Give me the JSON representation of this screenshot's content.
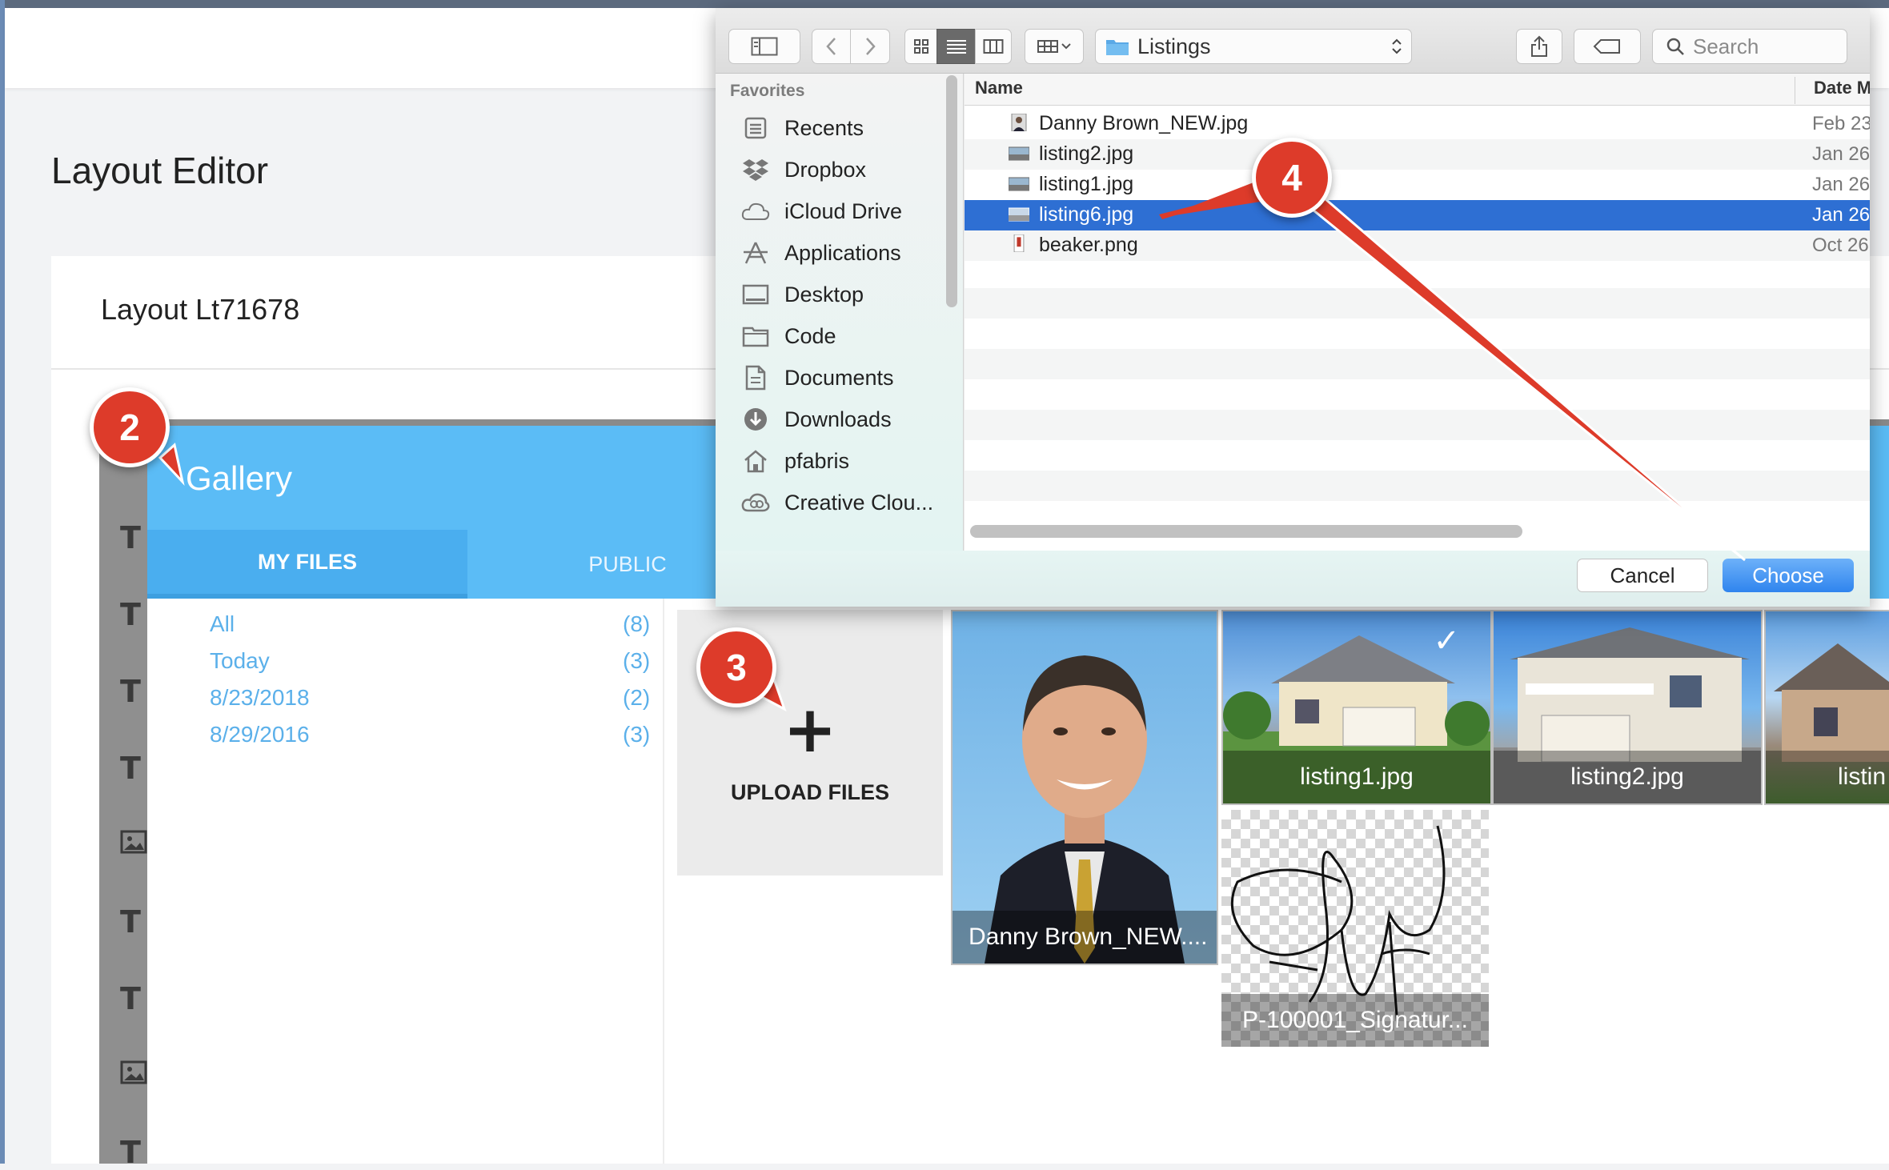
{
  "page": {
    "title": "Layout Editor",
    "layout_name": "Layout Lt71678"
  },
  "gallery": {
    "title": "Gallery",
    "tabs": [
      "MY FILES",
      "PUBLIC"
    ],
    "filters": [
      {
        "label": "All",
        "count": "(8)"
      },
      {
        "label": "Today",
        "count": "(3)"
      },
      {
        "label": "8/23/2018",
        "count": "(2)"
      },
      {
        "label": "8/29/2016",
        "count": "(3)"
      }
    ],
    "upload": {
      "plus": "+",
      "label": "UPLOAD FILES"
    },
    "tiles": [
      "Danny Brown_NEW....",
      "listing1.jpg",
      "listing2.jpg",
      "listin",
      "P-100001_Signatur..."
    ]
  },
  "dialog": {
    "location": "Listings",
    "search_placeholder": "Search",
    "sidebar_heading": "Favorites",
    "sidebar_items": [
      "Recents",
      "Dropbox",
      "iCloud Drive",
      "Applications",
      "Desktop",
      "Code",
      "Documents",
      "Downloads",
      "pfabris",
      "Creative Clou..."
    ],
    "columns": {
      "name": "Name",
      "date": "Date M"
    },
    "files": [
      {
        "name": "Danny Brown_NEW.jpg",
        "date": "Feb 23"
      },
      {
        "name": "listing2.jpg",
        "date": "Jan 26"
      },
      {
        "name": "listing1.jpg",
        "date": "Jan 26"
      },
      {
        "name": "listing6.jpg",
        "date": "Jan 26",
        "selected": true
      },
      {
        "name": "beaker.png",
        "date": "Oct 26"
      }
    ],
    "cancel": "Cancel",
    "choose": "Choose"
  },
  "callouts": [
    "2",
    "3",
    "4"
  ],
  "colors": {
    "gallery_blue": "#5bbcf6",
    "selection_blue": "#2e6fd3",
    "callout_red": "#dd3b2a",
    "link_blue": "#5bb0ea"
  },
  "icons": [
    "sidebar-toggle-icon",
    "back-icon",
    "forward-icon",
    "icon-view-icon",
    "list-view-icon",
    "column-view-icon",
    "gallery-view-icon",
    "folder-icon",
    "share-icon",
    "tag-icon",
    "search-icon",
    "checkmark-icon"
  ]
}
